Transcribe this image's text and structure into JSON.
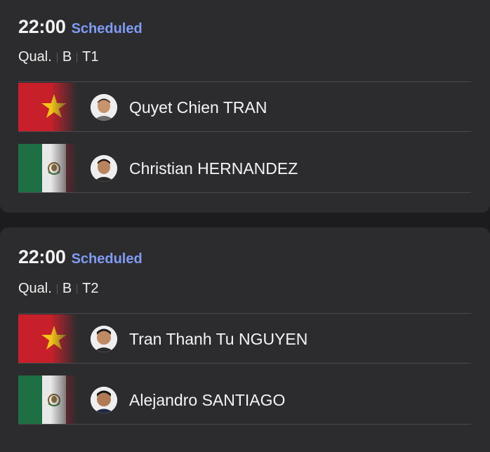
{
  "matches": [
    {
      "time": "22:00",
      "status": "Scheduled",
      "round": "Qual.",
      "group": "B",
      "table": "T1",
      "players": [
        {
          "name": "Quyet Chien TRAN",
          "flag": "vietnam-flag",
          "avatar": "player-photo"
        },
        {
          "name": "Christian HERNANDEZ",
          "flag": "mexico-flag",
          "avatar": "player-photo"
        }
      ]
    },
    {
      "time": "22:00",
      "status": "Scheduled",
      "round": "Qual.",
      "group": "B",
      "table": "T2",
      "players": [
        {
          "name": "Tran Thanh Tu NGUYEN",
          "flag": "vietnam-flag",
          "avatar": "player-photo"
        },
        {
          "name": "Alejandro SANTIAGO",
          "flag": "mexico-flag",
          "avatar": "player-photo"
        }
      ]
    }
  ],
  "colors": {
    "background": "#1c1c1e",
    "card": "#2c2c2e",
    "status": "#7f9cf5",
    "vietnam_red": "#c8202a",
    "vietnam_star": "#f5c518",
    "mexico_green": "#1f6f45",
    "mexico_white": "#e8e8e8",
    "mexico_red": "#a01b2c"
  }
}
